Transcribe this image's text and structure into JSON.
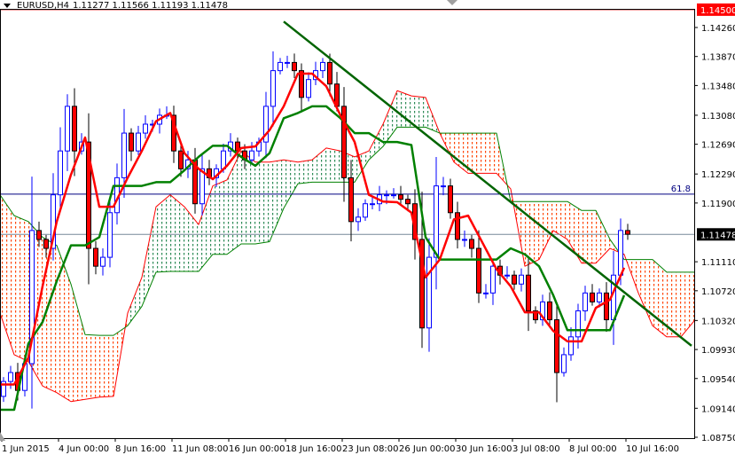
{
  "header": {
    "symbol": "EURUSD,H4",
    "ohlc": "1.11277 1.11566 1.11193 1.11478"
  },
  "colors": {
    "bull": "#0000ff",
    "bear": "#ff0000",
    "tenkan": "#ff0000",
    "kijun": "#008000",
    "cloud_bear": "#ff4500",
    "cloud_bull": "#2e8b57",
    "trendline": "#006400",
    "fib_line": "#000080",
    "bid_line": "#778899",
    "high_line": "#ff0000"
  },
  "chart_data": {
    "type": "candlestick",
    "title": "EURUSD,H4",
    "indicator": "Ichimoku Kinko Hyo",
    "ylim": [
      1.0875,
      1.1426
    ],
    "y_ticks": [
      "1.14260",
      "1.13870",
      "1.13480",
      "1.13080",
      "1.12690",
      "1.12290",
      "1.11900",
      "1.11110",
      "1.10720",
      "1.10320",
      "1.09930",
      "1.09540",
      "1.09140",
      "1.08750"
    ],
    "x_ticks": [
      "1 Jun 2015",
      "4 Jun 00:00",
      "8 Jun 16:00",
      "11 Jun 08:00",
      "16 Jun 00:00",
      "18 Jun 16:00",
      "23 Jun 08:00",
      "26 Jun 00:00",
      "30 Jun 16:00",
      "3 Jul 08:00",
      "8 Jul 00:00",
      "10 Jul 16:00"
    ],
    "first_open": 1.093,
    "closes": [
      1.095,
      1.0962,
      1.0938,
      1.0974,
      1.1153,
      1.1141,
      1.1129,
      1.1201,
      1.126,
      1.132,
      1.126,
      1.1272,
      1.1129,
      1.1105,
      1.1117,
      1.1177,
      1.1224,
      1.1284,
      1.126,
      1.1284,
      1.1296,
      1.1296,
      1.1308,
      1.1308,
      1.126,
      1.1236,
      1.1248,
      1.1189,
      1.1236,
      1.1224,
      1.1236,
      1.126,
      1.1272,
      1.126,
      1.1248,
      1.126,
      1.1272,
      1.132,
      1.1368,
      1.1379,
      1.1379,
      1.1368,
      1.1332,
      1.1356,
      1.1368,
      1.1379,
      1.135,
      1.132,
      1.1224,
      1.1165,
      1.1171,
      1.1189,
      1.1189,
      1.1201,
      1.1201,
      1.1201,
      1.1195,
      1.1189,
      1.1141,
      1.1022,
      1.1117,
      1.1213,
      1.1213,
      1.1177,
      1.1141,
      1.1141,
      1.1129,
      1.1069,
      1.1069,
      1.1105,
      1.1093,
      1.1093,
      1.1081,
      1.1093,
      1.1045,
      1.1033,
      1.1057,
      1.1033,
      1.0962,
      1.0986,
      1.101,
      1.1045,
      1.1069,
      1.1057,
      1.1069,
      1.1033,
      1.1093,
      1.1153,
      1.1148
    ],
    "line_step_bars": 2,
    "tenkan_sen": [
      1.0946,
      1.0946,
      1.0982,
      1.1078,
      1.1165,
      1.1228,
      1.1278,
      1.1185,
      1.1185,
      1.1224,
      1.126,
      1.13,
      1.1311,
      1.1257,
      1.1236,
      1.1222,
      1.124,
      1.1264,
      1.1266,
      1.1288,
      1.132,
      1.1364,
      1.1364,
      1.1347,
      1.1308,
      1.1272,
      1.1201,
      1.1192,
      1.1191,
      1.1177,
      1.109,
      1.1114,
      1.1168,
      1.1173,
      1.1137,
      1.1101,
      1.1078,
      1.1043,
      1.1043,
      1.1018,
      1.1004,
      1.1004,
      1.1049,
      1.106,
      1.1103
    ],
    "kijun_sen": [
      1.0912,
      1.0912,
      1.1001,
      1.103,
      1.1085,
      1.1133,
      1.1133,
      1.1144,
      1.1213,
      1.1213,
      1.1213,
      1.1218,
      1.1218,
      1.1234,
      1.1252,
      1.1267,
      1.1267,
      1.1252,
      1.124,
      1.1257,
      1.1304,
      1.1311,
      1.132,
      1.132,
      1.1304,
      1.1284,
      1.1284,
      1.1272,
      1.1272,
      1.1268,
      1.1144,
      1.1114,
      1.1114,
      1.1114,
      1.1114,
      1.1114,
      1.1129,
      1.1121,
      1.1105,
      1.1066,
      1.1019,
      1.1019,
      1.1019,
      1.1019,
      1.1066
    ],
    "senkou_span_a": [
      1.1042,
      1.0986,
      1.0977,
      1.0944,
      1.0935,
      1.0923,
      1.0926,
      1.0929,
      1.093,
      1.1042,
      1.109,
      1.1185,
      1.1201,
      1.1185,
      1.1161,
      1.1213,
      1.1221,
      1.126,
      1.1245,
      1.1245,
      1.1248,
      1.1245,
      1.1248,
      1.1264,
      1.126,
      1.1252,
      1.126,
      1.1296,
      1.1341,
      1.1334,
      1.1332,
      1.1284,
      1.1245,
      1.123,
      1.123,
      1.123,
      1.1209,
      1.1105,
      1.1114,
      1.1153,
      1.1141,
      1.1109,
      1.1109,
      1.1129,
      1.1121,
      1.1069,
      1.1025,
      1.101,
      1.101,
      1.1033
    ],
    "senkou_span_b": [
      1.1201,
      1.1173,
      1.1165,
      1.1144,
      1.1133,
      1.1081,
      1.1013,
      1.1012,
      1.1012,
      1.1025,
      1.1051,
      1.1097,
      1.1098,
      1.1098,
      1.1098,
      1.1121,
      1.1121,
      1.1135,
      1.1135,
      1.1138,
      1.1183,
      1.1216,
      1.1218,
      1.1218,
      1.1218,
      1.1218,
      1.1248,
      1.1266,
      1.1292,
      1.1292,
      1.1292,
      1.1284,
      1.1284,
      1.1284,
      1.1284,
      1.1284,
      1.1192,
      1.1192,
      1.1192,
      1.1192,
      1.1192,
      1.118,
      1.118,
      1.1141,
      1.1114,
      1.1114,
      1.1114,
      1.1097,
      1.1097,
      1.1097
    ],
    "trendline": {
      "start_bar": 39.5,
      "start_price": 1.1434,
      "end_bar": 97,
      "end_price": 1.0998
    },
    "levels": {
      "fib_label": "61.8",
      "fib_price": 1.1202,
      "bid_label": "1.11478",
      "bid_price": 1.11478,
      "high_label": "1.14500",
      "high_price": 1.145
    }
  }
}
